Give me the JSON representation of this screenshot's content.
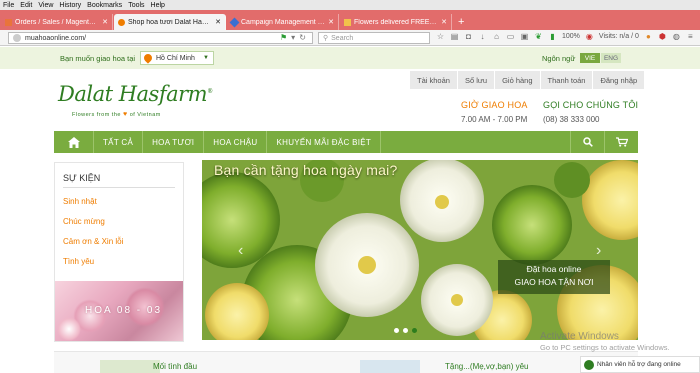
{
  "browser": {
    "menu": [
      "File",
      "Edit",
      "View",
      "History",
      "Bookmarks",
      "Tools",
      "Help"
    ],
    "tabs": [
      {
        "title": "Orders / Sales / Magento ...",
        "active": false,
        "fav_color": "#e9743b"
      },
      {
        "title": "Shop hoa tươi Dalat Hasfa...",
        "active": true,
        "fav_color": "#ef7d00"
      },
      {
        "title": "Campaign Management -...",
        "active": false,
        "fav_color": "#3b6fd1"
      },
      {
        "title": "Flowers delivered FREE | S...",
        "active": false,
        "fav_color": "#f2c24a"
      }
    ],
    "new_tab": "+",
    "url": "muahoaonline.com/",
    "search_placeholder": "Search",
    "zoom": "100%",
    "visits": "Visits: n/a / 0"
  },
  "site": {
    "deliver_label": "Bạn muốn giao hoa tại",
    "city": "Hồ Chí Minh",
    "lang_label": "Ngôn ngữ",
    "lang_vie": "VIE",
    "lang_eng": "ENG",
    "logo": "Dalat Hasfarm",
    "logo_reg": "®",
    "tagline_pre": "Flowers from the",
    "tagline_post": "of Vietnam",
    "user_links": [
      "Tài khoản",
      "Sổ lưu",
      "Giỏ hàng",
      "Thanh toán",
      "Đăng nhập"
    ],
    "hours_label": "GIỜ GIAO HOA",
    "hours_value": "7.00 AM - 7.00 PM",
    "call_label": "GỌI CHO CHÚNG TÔI",
    "call_value": "(08) 38 333 000",
    "nav": [
      "TẤT CẢ",
      "HOA TƯƠI",
      "HOA CHẬU",
      "KHUYẾN MÃI ĐẶC BIỆT"
    ],
    "sidebar_title": "SỰ KIỆN",
    "sidebar_items": [
      "Sinh nhật",
      "Chúc mừng",
      "Cảm ơn & Xin lỗi",
      "Tình yêu"
    ],
    "sidebar_banner": "HOA 08 - 03",
    "slide_headline": "Bạn cần tặng hoa ngày mai?",
    "slide_cta_1": "Đặt hoa online",
    "slide_cta_2": "GIAO HOA TẬN NƠI",
    "products": [
      "Mối tình đầu",
      "Tặng...(Mẹ,vợ,bạn) yêu"
    ],
    "activate_title": "Activate Windows",
    "activate_sub": "Go to PC settings to activate Windows.",
    "support": "Nhân viên hỗ trợ đang online"
  },
  "colors": {
    "tabbar": "#e26c6b",
    "brand_green": "#2f7d22",
    "nav_green": "#7aac3f",
    "accent_orange": "#ef7d00"
  }
}
